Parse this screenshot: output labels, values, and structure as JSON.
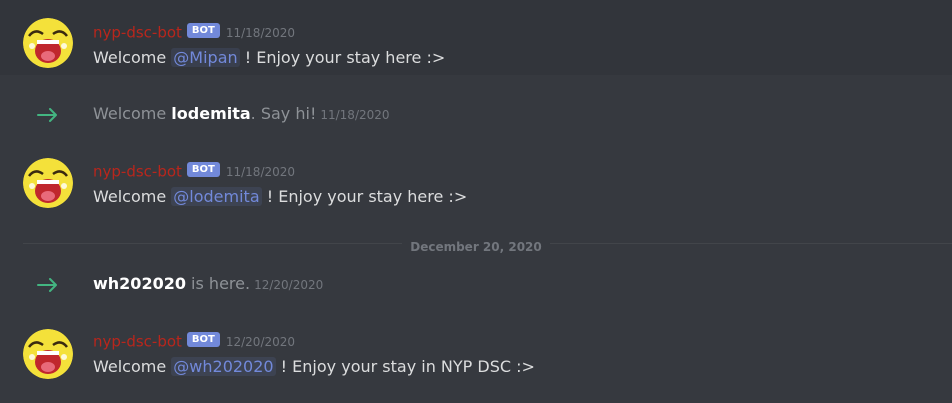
{
  "messages": [
    {
      "username": "nyp-dsc-bot",
      "bot_tag": "BOT",
      "timestamp": "11/18/2020",
      "text_before": "Welcome ",
      "mention": "@Mipan",
      "text_after": " ! Enjoy your stay here :>"
    },
    {
      "username": "nyp-dsc-bot",
      "bot_tag": "BOT",
      "timestamp": "11/18/2020",
      "text_before": "Welcome ",
      "mention": "@lodemita",
      "text_after": " ! Enjoy your stay here :>"
    },
    {
      "username": "nyp-dsc-bot",
      "bot_tag": "BOT",
      "timestamp": "12/20/2020",
      "text_before": "Welcome ",
      "mention": "@wh202020",
      "text_after": " ! Enjoy your stay in NYP DSC :>"
    }
  ],
  "joins": [
    {
      "prefix": "Welcome ",
      "user": "lodemita",
      "suffix": ". Say hi!",
      "timestamp": "11/18/2020"
    },
    {
      "prefix": "",
      "user": "wh202020",
      "suffix": " is here.",
      "timestamp": "12/20/2020"
    }
  ],
  "date_divider": "December 20, 2020",
  "colors": {
    "background": "#36393f",
    "bot_username": "#b9261c",
    "bot_tag": "#7289da",
    "mention": "#7289da",
    "join_arrow": "#43b581"
  },
  "icons": {
    "avatar": "laughing-face-avatar",
    "join": "right-arrow-icon"
  }
}
